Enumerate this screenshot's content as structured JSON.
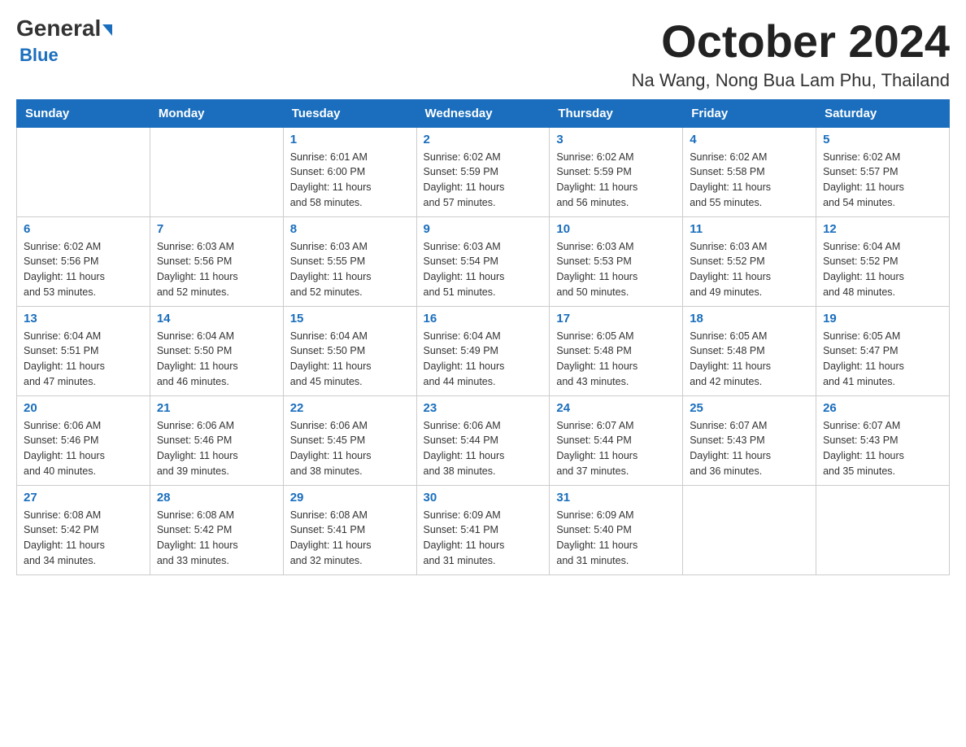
{
  "header": {
    "logo_general": "General",
    "logo_blue": "Blue",
    "month_title": "October 2024",
    "location": "Na Wang, Nong Bua Lam Phu, Thailand"
  },
  "days_of_week": [
    "Sunday",
    "Monday",
    "Tuesday",
    "Wednesday",
    "Thursday",
    "Friday",
    "Saturday"
  ],
  "weeks": [
    [
      {
        "day": "",
        "info": ""
      },
      {
        "day": "",
        "info": ""
      },
      {
        "day": "1",
        "info": "Sunrise: 6:01 AM\nSunset: 6:00 PM\nDaylight: 11 hours\nand 58 minutes."
      },
      {
        "day": "2",
        "info": "Sunrise: 6:02 AM\nSunset: 5:59 PM\nDaylight: 11 hours\nand 57 minutes."
      },
      {
        "day": "3",
        "info": "Sunrise: 6:02 AM\nSunset: 5:59 PM\nDaylight: 11 hours\nand 56 minutes."
      },
      {
        "day": "4",
        "info": "Sunrise: 6:02 AM\nSunset: 5:58 PM\nDaylight: 11 hours\nand 55 minutes."
      },
      {
        "day": "5",
        "info": "Sunrise: 6:02 AM\nSunset: 5:57 PM\nDaylight: 11 hours\nand 54 minutes."
      }
    ],
    [
      {
        "day": "6",
        "info": "Sunrise: 6:02 AM\nSunset: 5:56 PM\nDaylight: 11 hours\nand 53 minutes."
      },
      {
        "day": "7",
        "info": "Sunrise: 6:03 AM\nSunset: 5:56 PM\nDaylight: 11 hours\nand 52 minutes."
      },
      {
        "day": "8",
        "info": "Sunrise: 6:03 AM\nSunset: 5:55 PM\nDaylight: 11 hours\nand 52 minutes."
      },
      {
        "day": "9",
        "info": "Sunrise: 6:03 AM\nSunset: 5:54 PM\nDaylight: 11 hours\nand 51 minutes."
      },
      {
        "day": "10",
        "info": "Sunrise: 6:03 AM\nSunset: 5:53 PM\nDaylight: 11 hours\nand 50 minutes."
      },
      {
        "day": "11",
        "info": "Sunrise: 6:03 AM\nSunset: 5:52 PM\nDaylight: 11 hours\nand 49 minutes."
      },
      {
        "day": "12",
        "info": "Sunrise: 6:04 AM\nSunset: 5:52 PM\nDaylight: 11 hours\nand 48 minutes."
      }
    ],
    [
      {
        "day": "13",
        "info": "Sunrise: 6:04 AM\nSunset: 5:51 PM\nDaylight: 11 hours\nand 47 minutes."
      },
      {
        "day": "14",
        "info": "Sunrise: 6:04 AM\nSunset: 5:50 PM\nDaylight: 11 hours\nand 46 minutes."
      },
      {
        "day": "15",
        "info": "Sunrise: 6:04 AM\nSunset: 5:50 PM\nDaylight: 11 hours\nand 45 minutes."
      },
      {
        "day": "16",
        "info": "Sunrise: 6:04 AM\nSunset: 5:49 PM\nDaylight: 11 hours\nand 44 minutes."
      },
      {
        "day": "17",
        "info": "Sunrise: 6:05 AM\nSunset: 5:48 PM\nDaylight: 11 hours\nand 43 minutes."
      },
      {
        "day": "18",
        "info": "Sunrise: 6:05 AM\nSunset: 5:48 PM\nDaylight: 11 hours\nand 42 minutes."
      },
      {
        "day": "19",
        "info": "Sunrise: 6:05 AM\nSunset: 5:47 PM\nDaylight: 11 hours\nand 41 minutes."
      }
    ],
    [
      {
        "day": "20",
        "info": "Sunrise: 6:06 AM\nSunset: 5:46 PM\nDaylight: 11 hours\nand 40 minutes."
      },
      {
        "day": "21",
        "info": "Sunrise: 6:06 AM\nSunset: 5:46 PM\nDaylight: 11 hours\nand 39 minutes."
      },
      {
        "day": "22",
        "info": "Sunrise: 6:06 AM\nSunset: 5:45 PM\nDaylight: 11 hours\nand 38 minutes."
      },
      {
        "day": "23",
        "info": "Sunrise: 6:06 AM\nSunset: 5:44 PM\nDaylight: 11 hours\nand 38 minutes."
      },
      {
        "day": "24",
        "info": "Sunrise: 6:07 AM\nSunset: 5:44 PM\nDaylight: 11 hours\nand 37 minutes."
      },
      {
        "day": "25",
        "info": "Sunrise: 6:07 AM\nSunset: 5:43 PM\nDaylight: 11 hours\nand 36 minutes."
      },
      {
        "day": "26",
        "info": "Sunrise: 6:07 AM\nSunset: 5:43 PM\nDaylight: 11 hours\nand 35 minutes."
      }
    ],
    [
      {
        "day": "27",
        "info": "Sunrise: 6:08 AM\nSunset: 5:42 PM\nDaylight: 11 hours\nand 34 minutes."
      },
      {
        "day": "28",
        "info": "Sunrise: 6:08 AM\nSunset: 5:42 PM\nDaylight: 11 hours\nand 33 minutes."
      },
      {
        "day": "29",
        "info": "Sunrise: 6:08 AM\nSunset: 5:41 PM\nDaylight: 11 hours\nand 32 minutes."
      },
      {
        "day": "30",
        "info": "Sunrise: 6:09 AM\nSunset: 5:41 PM\nDaylight: 11 hours\nand 31 minutes."
      },
      {
        "day": "31",
        "info": "Sunrise: 6:09 AM\nSunset: 5:40 PM\nDaylight: 11 hours\nand 31 minutes."
      },
      {
        "day": "",
        "info": ""
      },
      {
        "day": "",
        "info": ""
      }
    ]
  ]
}
